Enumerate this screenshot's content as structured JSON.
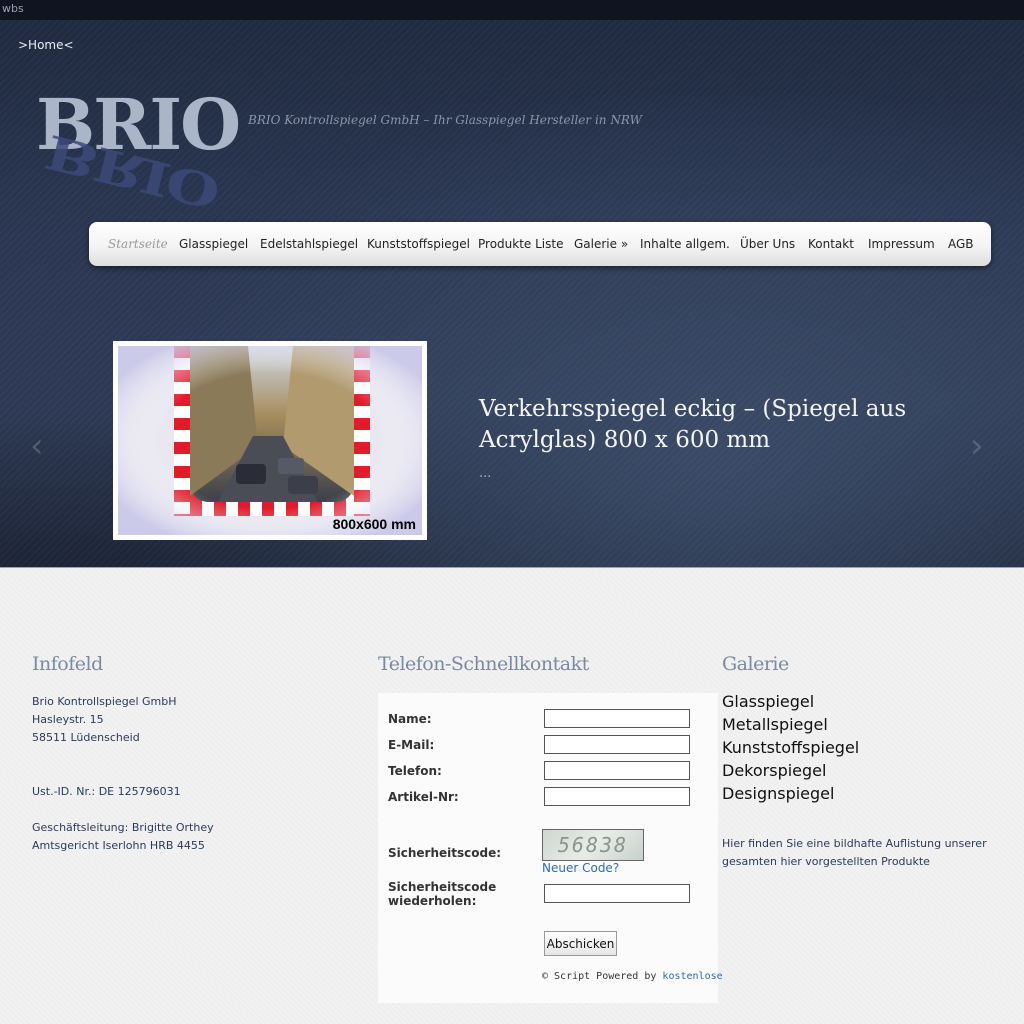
{
  "topbar": {
    "text": "wbs"
  },
  "header": {
    "home_link": ">Home<",
    "logo_text": "BRIO",
    "tagline": "BRIO Kontrollspiegel GmbH – Ihr Glasspiegel Hersteller in NRW"
  },
  "nav": {
    "items": [
      {
        "label": "Startseite",
        "active": true
      },
      {
        "label": "Glasspiegel"
      },
      {
        "label": "Edelstahlspiegel"
      },
      {
        "label": "Kunststoffspiegel"
      },
      {
        "label": "Produkte Liste"
      },
      {
        "label": "Galerie »"
      },
      {
        "label": "Inhalte allgem."
      },
      {
        "label": "Über Uns"
      },
      {
        "label": "Kontakt"
      },
      {
        "label": "Impressum"
      },
      {
        "label": "AGB"
      }
    ]
  },
  "slider": {
    "title": "Verkehrsspiegel eckig – (Spiegel aus Acrylglas) 800 x 600 mm",
    "more": "...",
    "image_caption": "800x600 mm",
    "prev_icon": "chevron-left-icon",
    "next_icon": "chevron-right-icon"
  },
  "infofeld": {
    "title": "Infofeld",
    "lines": [
      "Brio Kontrollspiegel GmbH",
      "Hasleystr. 15",
      "58511 Lüdenscheid",
      "",
      "",
      "Ust.-ID. Nr.: DE 125796031",
      "",
      "Geschäftsleitung: Brigitte Orthey",
      "Amtsgericht Iserlohn HRB 4455"
    ]
  },
  "contact": {
    "title": "Telefon-Schnellkontakt",
    "name_label": "Name:",
    "name_value": "",
    "email_label": "E-Mail:",
    "email_value": "",
    "phone_label": "Telefon:",
    "phone_value": "",
    "article_label": "Artikel-Nr:",
    "article_value": "",
    "security_label": "Sicherheitscode:",
    "captcha_text": "56838",
    "new_code": "Neuer Code?",
    "security_repeat_label_1": "Sicherheitscode",
    "security_repeat_label_2": "wiederholen:",
    "security_repeat_value": "",
    "submit": "Abschicken",
    "powered_prefix": "© Script Powered by",
    "powered_link": "kostenlose"
  },
  "galerie": {
    "title": "Galerie",
    "links": [
      "Glasspiegel",
      "Metallspiegel",
      "Kunststoffspiegel",
      "Dekorspiegel",
      "Designspiegel"
    ],
    "description": "Hier finden Sie eine bildhafte Auflistung unserer gesamten hier vorgestellten Produkte"
  }
}
